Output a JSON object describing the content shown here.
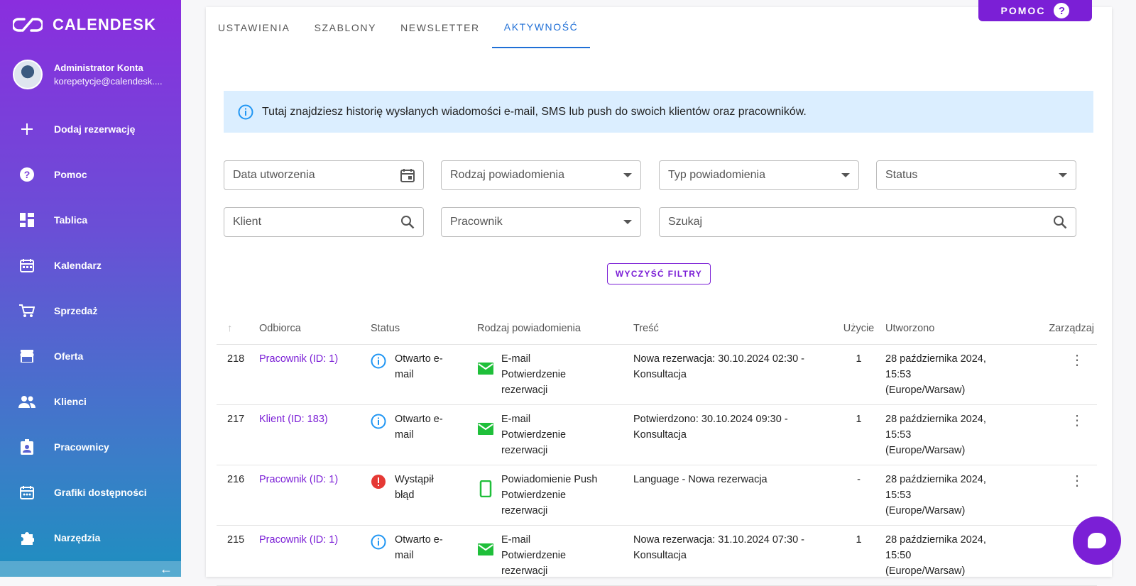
{
  "app": {
    "name": "CALENDESK"
  },
  "user": {
    "name": "Administrator Konta",
    "email": "korepetycje@calendesk...."
  },
  "nav": [
    {
      "label": "Dodaj rezerwację",
      "icon": "plus-icon"
    },
    {
      "label": "Pomoc",
      "icon": "help-icon"
    },
    {
      "label": "Tablica",
      "icon": "dashboard-icon"
    },
    {
      "label": "Kalendarz",
      "icon": "calendar-icon"
    },
    {
      "label": "Sprzedaż",
      "icon": "cart-icon"
    },
    {
      "label": "Oferta",
      "icon": "store-icon"
    },
    {
      "label": "Klienci",
      "icon": "people-icon"
    },
    {
      "label": "Pracownicy",
      "icon": "badge-icon"
    },
    {
      "label": "Grafiki dostępności",
      "icon": "schedule-icon"
    },
    {
      "label": "Narzędzia",
      "icon": "puzzle-icon"
    }
  ],
  "collapse_icon": "←",
  "help_button": {
    "label": "POMOC",
    "icon": "?"
  },
  "tabs": [
    {
      "label": "USTAWIENIA"
    },
    {
      "label": "SZABLONY"
    },
    {
      "label": "NEWSLETTER"
    },
    {
      "label": "AKTYWNOŚĆ",
      "active": true
    }
  ],
  "info_text": "Tutaj znajdziesz historię wysłanych wiadomości e-mail, SMS lub push do swoich klientów oraz pracowników.",
  "filters": {
    "created": "Data utworzenia",
    "kind": "Rodzaj powiadomienia",
    "type": "Typ powiadomienia",
    "status": "Status",
    "client": "Klient",
    "employee": "Pracownik",
    "search": "Szukaj",
    "clear": "WYCZYŚĆ FILTRY"
  },
  "table": {
    "sort_icon": "↑",
    "headers": {
      "recipient": "Odbiorca",
      "status": "Status",
      "kind": "Rodzaj powiadomienia",
      "content": "Treść",
      "usage": "Użycie",
      "created": "Utworzono",
      "manage": "Zarządzaj"
    },
    "rows": [
      {
        "id": "218",
        "recipient": "Pracownik (ID: 1)",
        "status": "Otwarto e-mail",
        "status_kind": "info",
        "kind": "E-mail",
        "kind_sub": "Potwierdzenie rezerwacji",
        "kind_icon": "mail",
        "content": "Nowa rezerwacja: 30.10.2024 02:30 - Konsultacja",
        "usage": "1",
        "created": "28 października 2024, 15:53 (Europe/Warsaw)"
      },
      {
        "id": "217",
        "recipient": "Klient (ID: 183)",
        "status": "Otwarto e-mail",
        "status_kind": "info",
        "kind": "E-mail",
        "kind_sub": "Potwierdzenie rezerwacji",
        "kind_icon": "mail",
        "content": "Potwierdzono: 30.10.2024 09:30 - Konsultacja",
        "usage": "1",
        "created": "28 października 2024, 15:53 (Europe/Warsaw)"
      },
      {
        "id": "216",
        "recipient": "Pracownik (ID: 1)",
        "status": "Wystąpił błąd",
        "status_kind": "error",
        "kind": "Powiadomienie Push",
        "kind_sub": "Potwierdzenie rezerwacji",
        "kind_icon": "phone",
        "content": "Language - Nowa rezerwacja",
        "usage": "-",
        "created": "28 października 2024, 15:53 (Europe/Warsaw)"
      },
      {
        "id": "215",
        "recipient": "Pracownik (ID: 1)",
        "status": "Otwarto e-mail",
        "status_kind": "info",
        "kind": "E-mail",
        "kind_sub": "Potwierdzenie rezerwacji",
        "kind_icon": "mail",
        "content": "Nowa rezerwacja: 31.10.2024 07:30 - Konsultacja",
        "usage": "1",
        "created": "28 października 2024, 15:50 (Europe/Warsaw)"
      }
    ]
  },
  "colors": {
    "accent": "#7b1fd6",
    "tab_active": "#1f6fd6",
    "info_bg": "#dbeeff",
    "mail_green": "#1fbf3a",
    "error_red": "#e53935",
    "info_blue": "#2196f3"
  }
}
